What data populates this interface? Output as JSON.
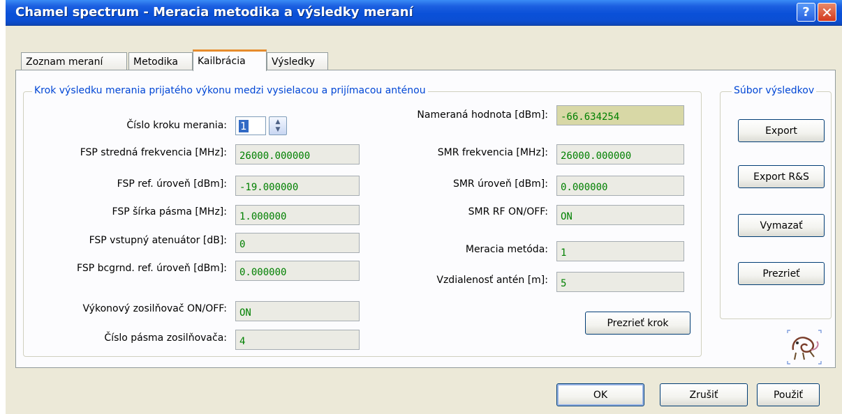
{
  "window": {
    "title": "Chamel spectrum - Meracia metodika a výsledky meraní",
    "help_label": "?",
    "close_label": "✕"
  },
  "tabs": [
    {
      "label": "Zoznam meraní",
      "active": false
    },
    {
      "label": "Metodika",
      "active": false
    },
    {
      "label": "Kailbrácia",
      "active": true
    },
    {
      "label": "Výsledky",
      "active": false
    }
  ],
  "step_group": {
    "legend": "Krok výsledku merania prijatého výkonu medzi vysielacou a prijímacou anténou",
    "step_number": {
      "label": "Číslo kroku merania:",
      "value": "1"
    },
    "left_fields": [
      {
        "label": "FSP stredná frekvencia [MHz]:",
        "value": "26000.000000"
      },
      {
        "label": "FSP ref. úroveň [dBm]:",
        "value": "-19.000000"
      },
      {
        "label": "FSP šírka pásma [MHz]:",
        "value": "1.000000"
      },
      {
        "label": "FSP vstupný atenuátor [dB]:",
        "value": "0"
      },
      {
        "label": "FSP bcgrnd. ref. úroveň [dBm]:",
        "value": "0.000000"
      },
      {
        "label": "Výkonový zosilňovač ON/OFF:",
        "value": "ON"
      },
      {
        "label": "Číslo pásma zosilňovača:",
        "value": "4"
      }
    ],
    "right_fields": [
      {
        "label": "Nameraná hodnota [dBm]:",
        "value": "-66.634254"
      },
      {
        "label": "SMR frekvencia [MHz]:",
        "value": "26000.000000"
      },
      {
        "label": "SMR úroveň [dBm]:",
        "value": "0.000000"
      },
      {
        "label": "SMR RF ON/OFF:",
        "value": "ON"
      },
      {
        "label": "Meracia metóda:",
        "value": "1"
      },
      {
        "label": "Vzdialenosť antén [m]:",
        "value": "5"
      }
    ],
    "view_step_button": "Prezrieť krok"
  },
  "results_group": {
    "legend": "Súbor výsledkov",
    "buttons": [
      "Export",
      "Export R&S",
      "Vymazať",
      "Prezrieť"
    ]
  },
  "footer": {
    "ok": "OK",
    "cancel": "Zrušiť",
    "apply": "Použiť"
  },
  "colors": {
    "value_text": "#008000",
    "legend_text": "#0046d5",
    "highlight_field": "#d8d8a6"
  },
  "icons": {
    "logo": "chameleon-logo-icon"
  }
}
